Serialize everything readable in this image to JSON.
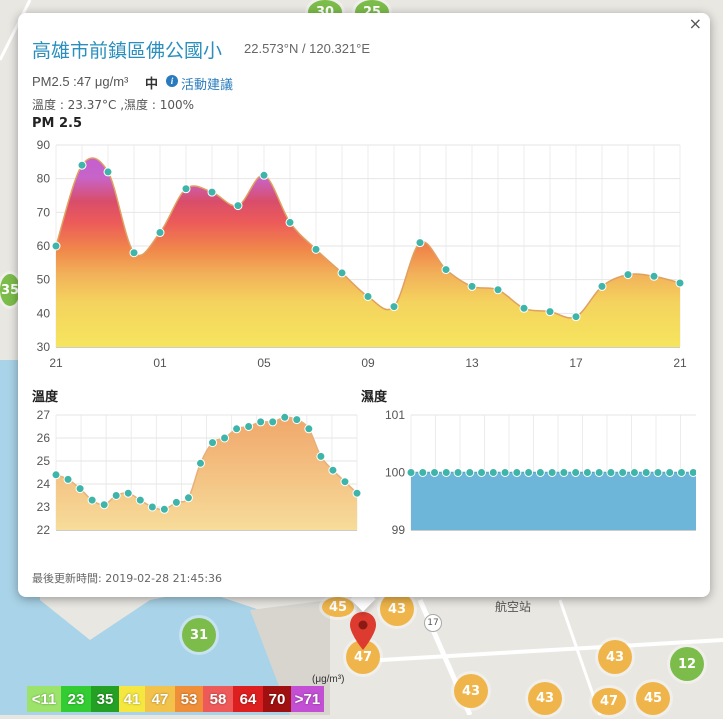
{
  "map": {
    "bubbles": [
      {
        "label": "30",
        "color": "green"
      },
      {
        "label": "25",
        "color": "green"
      },
      {
        "label": "35",
        "color": "green"
      },
      {
        "label": "31",
        "color": "green"
      },
      {
        "label": "45",
        "color": "orange"
      },
      {
        "label": "43",
        "color": "orange"
      },
      {
        "label": "47",
        "color": "orange"
      },
      {
        "label": "43",
        "color": "orange"
      },
      {
        "label": "43",
        "color": "orange"
      },
      {
        "label": "47",
        "color": "orange"
      },
      {
        "label": "45",
        "color": "orange"
      },
      {
        "label": "43",
        "color": "orange"
      },
      {
        "label": "12",
        "color": "green"
      }
    ],
    "place_label": "航空站",
    "road_label": "17"
  },
  "popup": {
    "title": "高雄市前鎮區佛公國小",
    "coords": "22.573°N / 120.321°E",
    "pm_line": "PM2.5 :47 μg/m³",
    "pm_level": "中",
    "info_icon": "i",
    "advice": "活動建議",
    "weather": "溫度 : 23.37°C ,濕度 : 100%",
    "close": "×",
    "updated": "最後更新時間: 2019-02-28 21:45:36"
  },
  "legend": {
    "unit": "(μg/m³)",
    "cells": [
      {
        "label": "<11",
        "color": "#9be36a"
      },
      {
        "label": "23",
        "color": "#33cc33"
      },
      {
        "label": "35",
        "color": "#24a124"
      },
      {
        "label": "41",
        "color": "#f5e640"
      },
      {
        "label": "47",
        "color": "#f2c24a"
      },
      {
        "label": "53",
        "color": "#ef8f3a"
      },
      {
        "label": "58",
        "color": "#ee5a5a"
      },
      {
        "label": "64",
        "color": "#dd1f1f"
      },
      {
        "label": "70",
        "color": "#a01010"
      },
      {
        "label": ">71",
        "color": "#c24fd4"
      }
    ]
  },
  "chart_data": [
    {
      "type": "area",
      "title": "PM 2.5",
      "ylim": [
        30,
        90
      ],
      "yticks": [
        30,
        40,
        50,
        60,
        70,
        80,
        90
      ],
      "xticks": [
        "21",
        "01",
        "05",
        "09",
        "13",
        "17",
        "21"
      ],
      "values": [
        60,
        84,
        82,
        58,
        64,
        77,
        76,
        72,
        81,
        67,
        59,
        52,
        45,
        42,
        61,
        53,
        48,
        47,
        41.5,
        40.5,
        39,
        48,
        51.5,
        51,
        49
      ]
    },
    {
      "type": "area",
      "title": "溫度",
      "ylim": [
        22,
        27
      ],
      "yticks": [
        22,
        23,
        24,
        25,
        26,
        27
      ],
      "values": [
        24.4,
        24.2,
        23.8,
        23.3,
        23.1,
        23.5,
        23.6,
        23.3,
        23.0,
        22.9,
        23.2,
        23.4,
        24.9,
        25.8,
        26.0,
        26.4,
        26.5,
        26.7,
        26.7,
        26.9,
        26.8,
        26.4,
        25.2,
        24.6,
        24.1,
        23.6
      ]
    },
    {
      "type": "area",
      "title": "濕度",
      "ylim": [
        99,
        101
      ],
      "yticks": [
        99,
        100,
        101
      ],
      "values": [
        100,
        100,
        100,
        100,
        100,
        100,
        100,
        100,
        100,
        100,
        100,
        100,
        100,
        100,
        100,
        100,
        100,
        100,
        100,
        100,
        100,
        100,
        100,
        100,
        100,
        100
      ]
    }
  ]
}
